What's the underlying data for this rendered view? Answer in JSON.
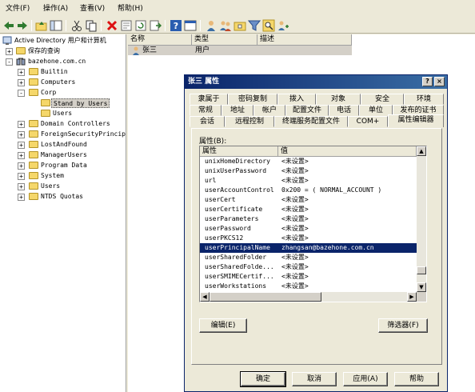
{
  "menubar": {
    "items": [
      "文件(F)",
      "操作(A)",
      "查看(V)",
      "帮助(H)"
    ]
  },
  "toolbar": {
    "icons": [
      "back-icon",
      "forward-icon",
      "up-folder-icon",
      "console-tree-icon",
      "cut-icon",
      "copy-icon",
      "delete-icon",
      "properties-icon",
      "refresh-icon",
      "export-icon",
      "help-icon",
      "console-icon",
      "user-icon",
      "group-icon",
      "ou-icon",
      "filter-icon",
      "find-icon",
      "add-to-group-icon"
    ]
  },
  "tree": {
    "root": "Active Directory 用户和计算机",
    "items": [
      {
        "label": "保存的查询",
        "level": 1,
        "expander": "+"
      },
      {
        "label": "bazehone.com.cn",
        "level": 1,
        "expander": "-"
      },
      {
        "label": "Builtin",
        "level": 2,
        "expander": "+"
      },
      {
        "label": "Computers",
        "level": 2,
        "expander": "+"
      },
      {
        "label": "Corp",
        "level": 2,
        "expander": "-"
      },
      {
        "label": "Stand by Users",
        "level": 3,
        "expander": "",
        "selected": true
      },
      {
        "label": "Users",
        "level": 3,
        "expander": ""
      },
      {
        "label": "Domain Controllers",
        "level": 2,
        "expander": "+"
      },
      {
        "label": "ForeignSecurityPrincip",
        "level": 2,
        "expander": "+"
      },
      {
        "label": "LostAndFound",
        "level": 2,
        "expander": "+"
      },
      {
        "label": "ManagerUsers",
        "level": 2,
        "expander": "+"
      },
      {
        "label": "Program Data",
        "level": 2,
        "expander": "+"
      },
      {
        "label": "System",
        "level": 2,
        "expander": "+"
      },
      {
        "label": "Users",
        "level": 2,
        "expander": "+"
      },
      {
        "label": "NTDS Quotas",
        "level": 2,
        "expander": "+"
      }
    ]
  },
  "list": {
    "columns": [
      "名称",
      "类型",
      "描述"
    ],
    "rows": [
      {
        "name": "张三",
        "type": "用户",
        "desc": ""
      }
    ]
  },
  "dialog": {
    "title": "张三 属性",
    "help_button": "?",
    "close_button": "×",
    "tabs_row1": [
      "隶属于",
      "密码复制",
      "拨入",
      "对象",
      "安全",
      "环境"
    ],
    "tabs_row2": [
      "常规",
      "地址",
      "帐户",
      "配置文件",
      "电话",
      "单位",
      "发布的证书"
    ],
    "tabs_row3": [
      "会话",
      "远程控制",
      "终端服务配置文件",
      "COM+",
      "属性编辑器"
    ],
    "attributes_label": "属性(B):",
    "attr_columns": [
      "属性",
      "值"
    ],
    "attributes": [
      {
        "name": "unixHomeDirectory",
        "value": "<未设置>"
      },
      {
        "name": "unixUserPassword",
        "value": "<未设置>"
      },
      {
        "name": "url",
        "value": "<未设置>"
      },
      {
        "name": "userAccountControl",
        "value": "0x200 = ( NORMAL_ACCOUNT )"
      },
      {
        "name": "userCert",
        "value": "<未设置>"
      },
      {
        "name": "userCertificate",
        "value": "<未设置>"
      },
      {
        "name": "userParameters",
        "value": "<未设置>"
      },
      {
        "name": "userPassword",
        "value": "<未设置>"
      },
      {
        "name": "userPKCS12",
        "value": "<未设置>"
      },
      {
        "name": "userPrincipalName",
        "value": "zhangsan@bazehone.com.cn",
        "selected": true
      },
      {
        "name": "userSharedFolder",
        "value": "<未设置>"
      },
      {
        "name": "userSharedFolde...",
        "value": "<未设置>"
      },
      {
        "name": "userSMIMECertif...",
        "value": "<未设置>"
      },
      {
        "name": "userWorkstations",
        "value": "<未设置>"
      }
    ],
    "edit_button": "编辑(E)",
    "filter_button": "筛选器(F)",
    "ok_button": "确定",
    "cancel_button": "取消",
    "apply_button": "应用(A)",
    "help_button_label": "帮助"
  }
}
